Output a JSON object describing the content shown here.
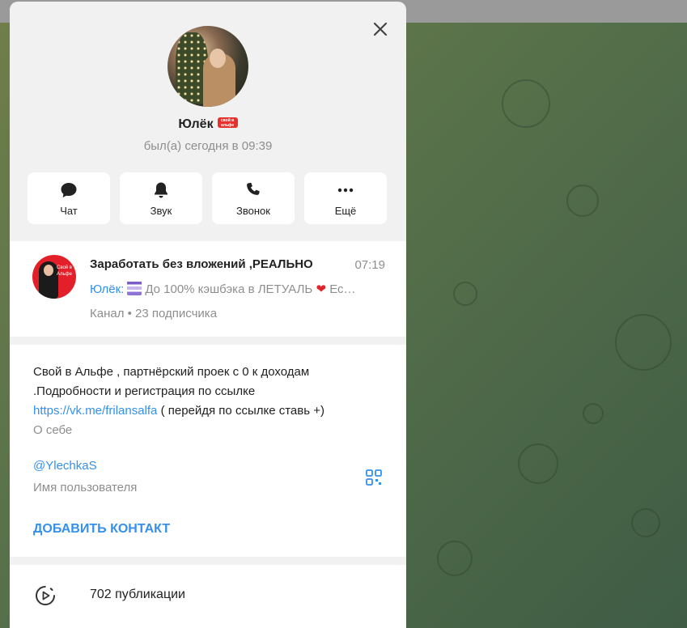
{
  "profile": {
    "name": "Юлёк",
    "badge_text": "свой в альфе",
    "status": "был(а) сегодня в 09:39"
  },
  "actions": [
    {
      "label": "Чат",
      "icon": "chat-icon"
    },
    {
      "label": "Звук",
      "icon": "bell-icon"
    },
    {
      "label": "Звонок",
      "icon": "phone-icon"
    },
    {
      "label": "Ещё",
      "icon": "more-icon"
    }
  ],
  "channel": {
    "title": "Заработать без вложений ,РЕАЛЬНО",
    "time": "07:19",
    "sender": "Юлёк:",
    "message": "До 100% кэшбэка в ЛЕТУАЛЬ",
    "message_tail": " Ес…",
    "subtitle": "Канал • 23 подписчика",
    "avatar_text": "Свой в Альфе"
  },
  "info": {
    "bio_line1": "Свой в Альфе , партнёрский проек с 0 к доходам",
    "bio_line2": ".Подробности и регистрация по ссылке",
    "bio_link": "https://vk.me/frilansalfa",
    "bio_tail": " ( перейдя по ссылке ставь +)",
    "bio_label": "О себе",
    "username": "@YlechkaS",
    "username_label": "Имя пользователя",
    "add_contact": "ДОБАВИТЬ КОНТАКТ"
  },
  "media": {
    "label": "702 публикации",
    "icon": "play-circle-icon"
  },
  "colors": {
    "accent": "#3390ec",
    "muted": "#8e8e8e",
    "badge": "#e8302a"
  }
}
